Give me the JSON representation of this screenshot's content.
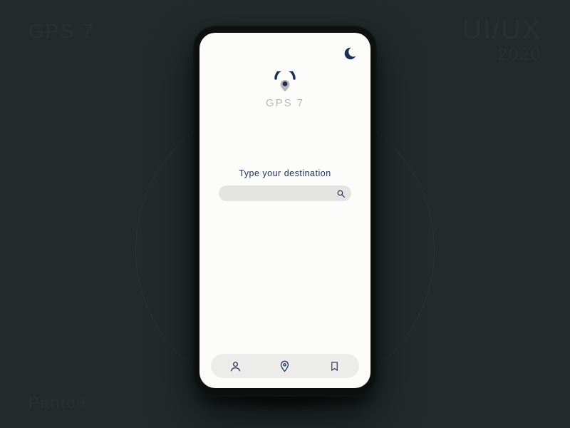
{
  "background": {
    "top_left": "GPS 7",
    "top_right": "UI/UX",
    "top_right_year": "2020",
    "bottom_left": "Panto9"
  },
  "app": {
    "brand_name": "GPS 7",
    "search_label": "Type your destination",
    "search_value": "",
    "search_placeholder": ""
  },
  "colors": {
    "accent": "#1e2f55",
    "muted": "#b7b7b5",
    "pill": "#e4e4e1"
  },
  "nav": {
    "items": [
      {
        "name": "profile"
      },
      {
        "name": "location"
      },
      {
        "name": "bookmark"
      }
    ]
  }
}
